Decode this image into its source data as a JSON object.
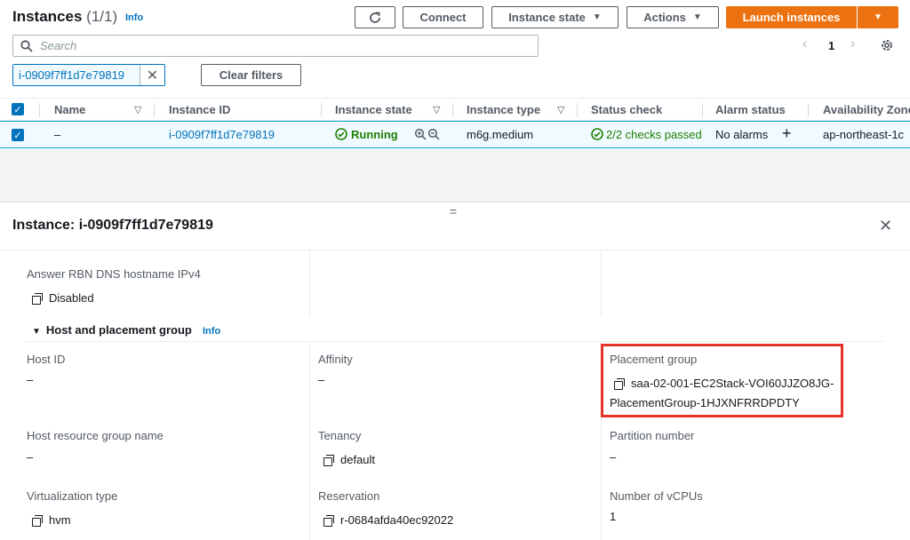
{
  "header": {
    "title": "Instances",
    "count": "(1/1)",
    "info": "Info",
    "connect": "Connect",
    "instance_state": "Instance state",
    "actions": "Actions",
    "launch": "Launch instances"
  },
  "search": {
    "placeholder": "Search"
  },
  "pager": {
    "page": "1"
  },
  "filter": {
    "token": "i-0909f7ff1d7e79819",
    "clear": "Clear filters"
  },
  "table": {
    "columns": [
      "Name",
      "Instance ID",
      "Instance state",
      "Instance type",
      "Status check",
      "Alarm status",
      "Availability Zone"
    ],
    "row": {
      "name": "–",
      "instance_id": "i-0909f7ff1d7e79819",
      "state": "Running",
      "type": "m6g.medium",
      "status_check": "2/2 checks passed",
      "alarm": "No alarms",
      "az": "ap-northeast-1c"
    }
  },
  "details": {
    "handle": "=",
    "title": "Instance: i-0909f7ff1d7e79819",
    "rbn_label": "Answer RBN DNS hostname IPv4",
    "rbn_value": "Disabled",
    "section": "Host and placement group",
    "section_info": "Info",
    "host_id_label": "Host ID",
    "host_id_value": "–",
    "affinity_label": "Affinity",
    "affinity_value": "–",
    "placement_label": "Placement group",
    "placement_value_1": "saa-02-001-EC2Stack-VOI60JJZO8JG-",
    "placement_value_2": "PlacementGroup-1HJXNFRRDPDTY",
    "hrg_label": "Host resource group name",
    "hrg_value": "–",
    "tenancy_label": "Tenancy",
    "tenancy_value": "default",
    "partition_label": "Partition number",
    "partition_value": "–",
    "virt_label": "Virtualization type",
    "virt_value": "hvm",
    "reservation_label": "Reservation",
    "reservation_value": "r-0684afda40ec92022",
    "vcpu_label": "Number of vCPUs",
    "vcpu_value": "1"
  },
  "colors": {
    "accent": "#0073bb",
    "primary": "#ec7211",
    "success": "#1d8102",
    "highlight": "#e5332a"
  }
}
